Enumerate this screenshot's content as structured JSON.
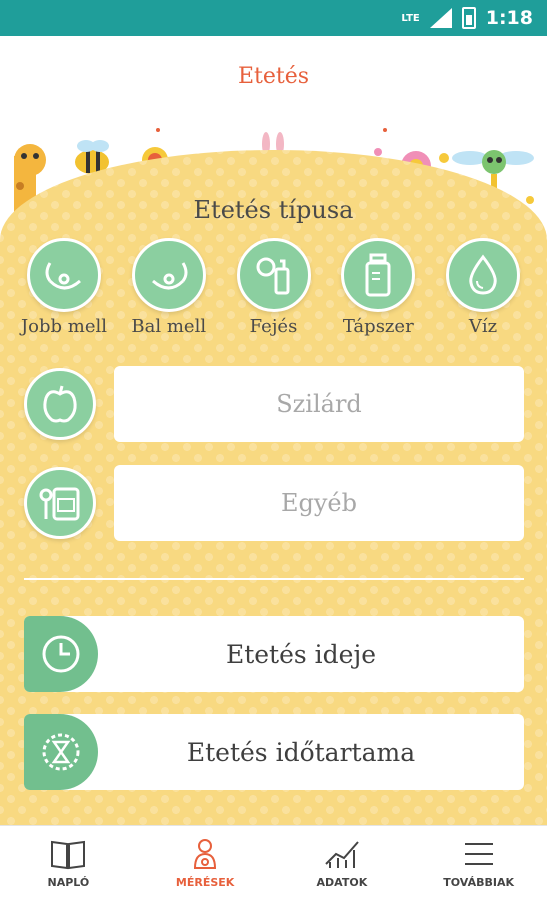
{
  "status_bar": {
    "network": "LTE",
    "time": "1:18"
  },
  "header": {
    "title": "Etetés"
  },
  "feeding_type": {
    "title": "Etetés típusa",
    "options": [
      {
        "label": "Jobb mell",
        "icon": "breast-right-icon"
      },
      {
        "label": "Bal mell",
        "icon": "breast-left-icon"
      },
      {
        "label": "Fejés",
        "icon": "breast-pump-icon"
      },
      {
        "label": "Tápszer",
        "icon": "formula-bottle-icon"
      },
      {
        "label": "Víz",
        "icon": "water-drop-icon"
      }
    ]
  },
  "inputs": {
    "solid": {
      "placeholder": "Szilárd",
      "value": "",
      "icon": "apple-icon"
    },
    "other": {
      "placeholder": "Egyéb",
      "value": "",
      "icon": "baby-food-jar-icon"
    }
  },
  "actions": {
    "feeding_time": {
      "label": "Etetés ideje",
      "icon": "clock-icon"
    },
    "feeding_duration": {
      "label": "Etetés időtartama",
      "icon": "hourglass-icon"
    }
  },
  "bottom_nav": {
    "items": [
      {
        "label": "NAPLÓ",
        "icon": "book-icon",
        "active": false
      },
      {
        "label": "MÉRÉSEK",
        "icon": "baby-icon",
        "active": true
      },
      {
        "label": "ADATOK",
        "icon": "chart-icon",
        "active": false
      },
      {
        "label": "TOVÁBBIAK",
        "icon": "menu-icon",
        "active": false
      }
    ]
  },
  "colors": {
    "status_bar": "#1f9e9a",
    "accent": "#e7603c",
    "panel": "#f8d981",
    "green": "#8bcfa0"
  }
}
